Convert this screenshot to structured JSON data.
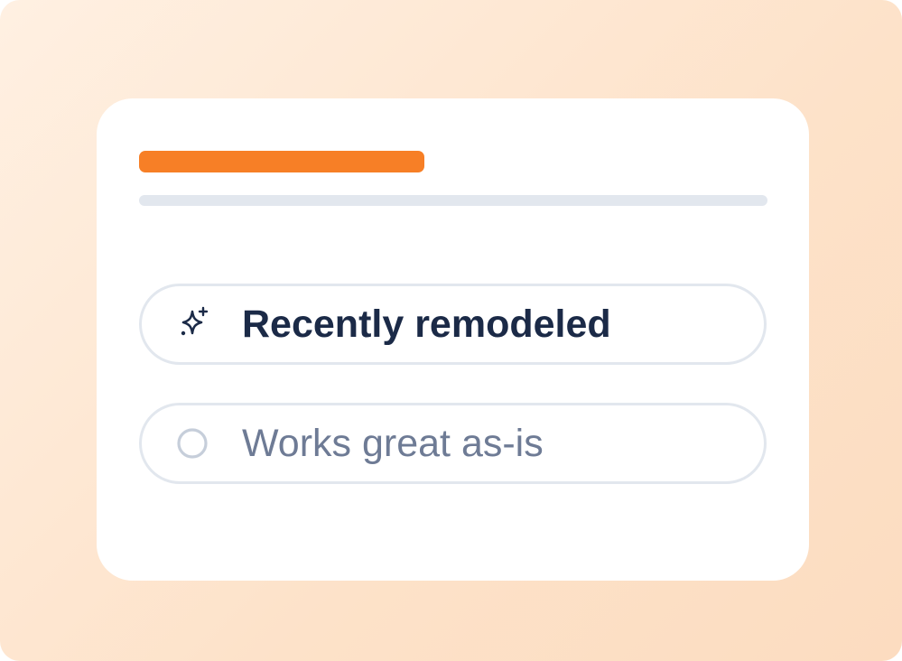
{
  "colors": {
    "accent": "#f77f26",
    "placeholder_bar": "#e2e7ee",
    "text_selected": "#1b2a47",
    "text_unselected": "#6e7b95",
    "radio_border": "#c6ceda"
  },
  "question": {
    "title_placeholder_icon": "bar-placeholder",
    "subtitle_placeholder_icon": "bar-placeholder"
  },
  "options": [
    {
      "label": "Recently remodeled",
      "icon": "sparkles-icon",
      "selected": true
    },
    {
      "label": "Works great as-is",
      "icon": "radio-circle-icon",
      "selected": false
    }
  ]
}
